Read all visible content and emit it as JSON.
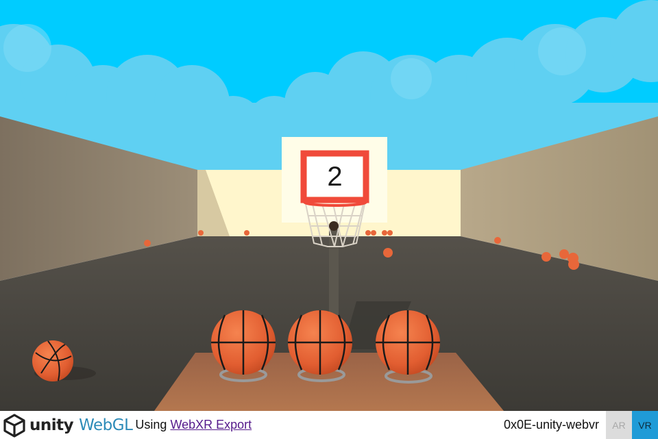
{
  "game": {
    "score": "2"
  },
  "footer": {
    "unity_label": "unity",
    "webgl_label": "WebGL",
    "using_text": "Using",
    "webxr_link": "WebXR Export",
    "project_title": "0x0E-unity-webvr",
    "ar_button": "AR",
    "vr_button": "VR"
  },
  "colors": {
    "sky": "#00ccff",
    "clouds": "#5fd0f2",
    "wall_left": "#8d7e6a",
    "back_wall": "#fff6cc",
    "floor": "#4d4a42",
    "ball": "#e8673a",
    "rim": "#f04a3a",
    "table": "#a8694a",
    "webgl_blue": "#2d8bb8",
    "vr_button_bg": "#1f9bd7",
    "ar_button_bg": "#dcdcdc"
  }
}
